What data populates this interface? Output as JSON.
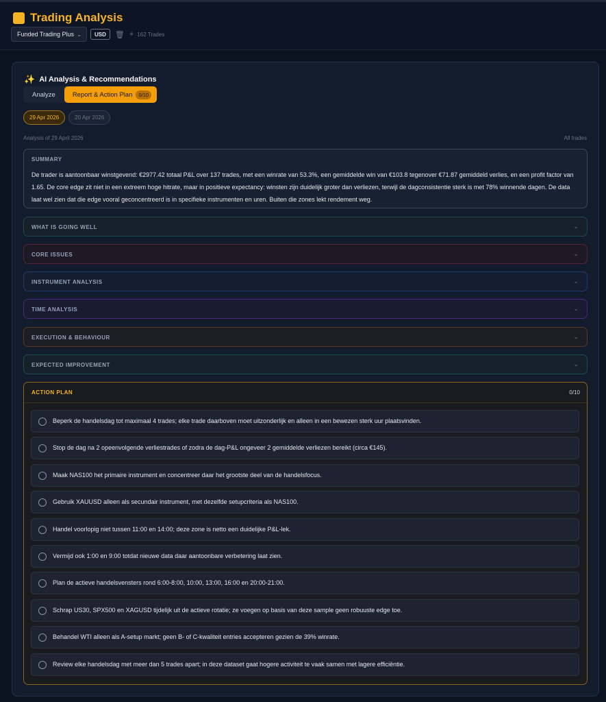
{
  "header": {
    "title": "Trading Analysis",
    "account": "Funded Trading Plus",
    "currency": "USD",
    "trade_count": "162 Trades",
    "delete_icon": "trash-icon",
    "add_icon": "plus-icon"
  },
  "ai": {
    "title": "AI Analysis & Recommendations",
    "icon": "sparkle-icon",
    "tabs": [
      {
        "label": "Analyze"
      },
      {
        "label": "Report & Action Plan",
        "badge": "0/10"
      }
    ],
    "dates": [
      "29 Apr 2026",
      "20 Apr 2026"
    ],
    "analysis_of": "Analysis of 29 April 2026",
    "scope": "All trades"
  },
  "summary": {
    "title": "SUMMARY",
    "text": "De trader is aantoonbaar winstgevend: €2977.42 totaal P&L over 137 trades, met een winrate van 53.3%, een gemiddelde win van €103.8 tegenover €71.87 gemiddeld verlies, en een profit factor van 1.65. De core edge zit niet in een extreem hoge hitrate, maar in positieve expectancy: winsten zijn duidelijk groter dan verliezen, terwijl de dagconsistentie sterk is met 78% winnende dagen. De data laat wel zien dat die edge vooral geconcentreerd is in specifieke instrumenten en uren. Buiten die zones lekt rendement weg."
  },
  "sections": [
    {
      "title": "WHAT IS GOING WELL",
      "color": "#1e4a4a"
    },
    {
      "title": "CORE ISSUES",
      "color": "#5a2233"
    },
    {
      "title": "INSTRUMENT ANALYSIS",
      "color": "#1e3a6e"
    },
    {
      "title": "TIME ANALYSIS",
      "color": "#4a2780"
    },
    {
      "title": "EXECUTION & BEHAVIOUR",
      "color": "#5a3a1a"
    },
    {
      "title": "EXPECTED IMPROVEMENT",
      "color": "#1b4f4a"
    }
  ],
  "action_plan": {
    "title": "ACTION PLAN",
    "count": "0/10",
    "items": [
      "Beperk de handelsdag tot maximaal 4 trades; elke trade daarboven moet uitzonderlijk en alleen in een bewezen sterk uur plaatsvinden.",
      "Stop de dag na 2 opeenvolgende verliestrades of zodra de dag-P&L ongeveer 2 gemiddelde verliezen bereikt (circa €145).",
      "Maak NAS100 het primaire instrument en concentreer daar het grootste deel van de handelsfocus.",
      "Gebruik XAUUSD alleen als secundair instrument, met dezelfde setupcriteria als NAS100.",
      "Handel voorlopig niet tussen 11:00 en 14:00; deze zone is netto een duidelijke P&L-lek.",
      "Vermijd ook 1:00 en 9:00 totdat nieuwe data daar aantoonbare verbetering laat zien.",
      "Plan de actieve handelsvensters rond 6:00-8:00, 10:00, 13:00, 16:00 en 20:00-21:00.",
      "Schrap US30, SPX500 en XAGUSD tijdelijk uit de actieve rotatie; ze voegen op basis van deze sample geen robuuste edge toe.",
      "Behandel WTI alleen als A-setup markt; geen B- of C-kwaliteit entries accepteren gezien de 39% winrate.",
      "Review elke handelsdag met meer dan 5 trades apart; in deze dataset gaat hogere activiteit te vaak samen met lagere efficiëntie."
    ]
  },
  "colors": {
    "accent": "#f5b324",
    "background": "#0b1220",
    "card": "#131c2c"
  }
}
